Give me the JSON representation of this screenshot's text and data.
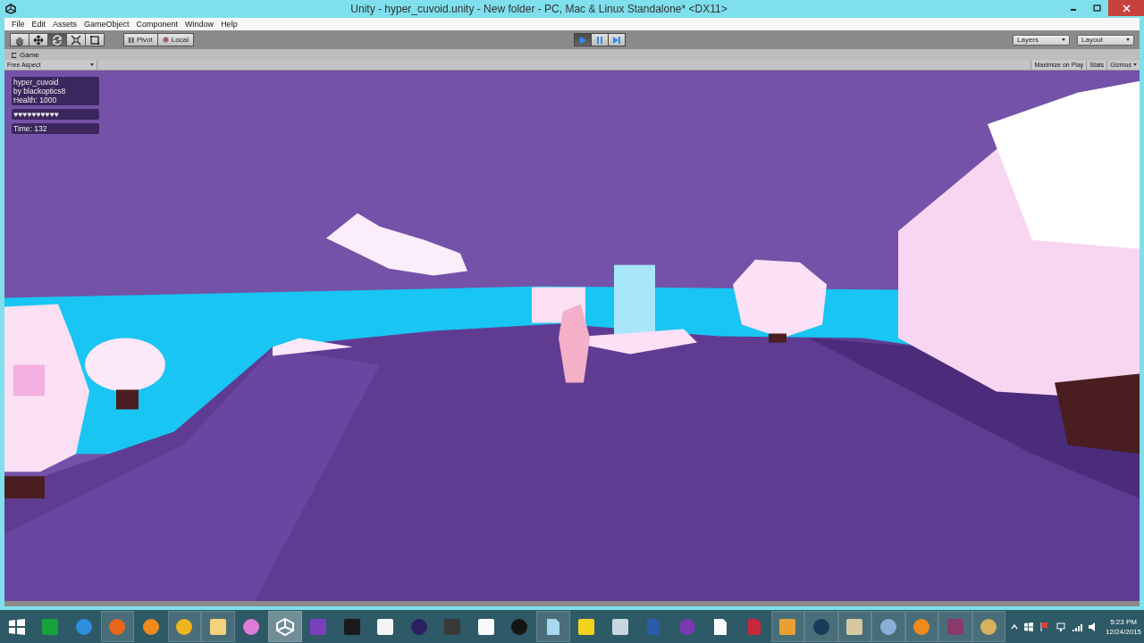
{
  "window": {
    "title": "Unity - hyper_cuvoid.unity - New folder - PC, Mac & Linux Standalone* <DX11>"
  },
  "menu": [
    "File",
    "Edit",
    "Assets",
    "GameObject",
    "Component",
    "Window",
    "Help"
  ],
  "tools": [
    {
      "kind": "hand",
      "selected": false
    },
    {
      "kind": "move",
      "selected": false
    },
    {
      "kind": "rotate",
      "selected": true
    },
    {
      "kind": "scale",
      "selected": false
    },
    {
      "kind": "rect",
      "selected": false
    }
  ],
  "pivot_buttons": [
    {
      "kind": "pivot",
      "label": "Pivot"
    },
    {
      "kind": "local",
      "label": "Local"
    }
  ],
  "playback": [
    {
      "kind": "play",
      "selected": true
    },
    {
      "kind": "pause",
      "selected": false
    },
    {
      "kind": "step",
      "selected": false
    }
  ],
  "dropdowns": [
    "Layers",
    "Layout"
  ],
  "game_panel": {
    "tab": "Game",
    "aspect": "Free Aspect",
    "options": [
      "Maximize on Play",
      "Stats",
      "Gizmos"
    ]
  },
  "hud": {
    "info": [
      "hyper_cuvoid",
      "by blackoptics8",
      "Health: 1000"
    ],
    "hearts": "♥♥♥♥♥♥♥♥♥♥",
    "time": "Time: 132"
  },
  "taskbar": {
    "apps": [
      {
        "kind": "tiles",
        "color": "#ffffff",
        "running": false,
        "selected": false
      },
      {
        "kind": "square",
        "color": "#18a33a",
        "running": false,
        "selected": false
      },
      {
        "kind": "circle",
        "color": "#2f8fdc",
        "running": false,
        "selected": false
      },
      {
        "kind": "circle",
        "color": "#e8661c",
        "running": true,
        "selected": false
      },
      {
        "kind": "circle",
        "color": "#f08a1c",
        "running": false,
        "selected": false
      },
      {
        "kind": "circle",
        "color": "#f0b41c",
        "running": true,
        "selected": false
      },
      {
        "kind": "square",
        "color": "#f2d27a",
        "running": true,
        "selected": false
      },
      {
        "kind": "circle",
        "color": "#e07ad8",
        "running": false,
        "selected": false
      },
      {
        "kind": "triangle",
        "color": "#ffffff",
        "running": true,
        "selected": true
      },
      {
        "kind": "square",
        "color": "#7b3fbf",
        "running": false,
        "selected": false
      },
      {
        "kind": "square",
        "color": "#1a1a1a",
        "running": false,
        "selected": false
      },
      {
        "kind": "square",
        "color": "#f4f4f4",
        "running": false,
        "selected": false
      },
      {
        "kind": "circle",
        "color": "#2c2060",
        "running": false,
        "selected": false
      },
      {
        "kind": "square",
        "color": "#3a3a3a",
        "running": false,
        "selected": false
      },
      {
        "kind": "square",
        "color": "#fafafa",
        "running": false,
        "selected": false
      },
      {
        "kind": "circle",
        "color": "#151515",
        "running": false,
        "selected": false
      },
      {
        "kind": "page",
        "color": "#a8d8f0",
        "running": true,
        "selected": false
      },
      {
        "kind": "square",
        "color": "#f2d21c",
        "running": false,
        "selected": false
      },
      {
        "kind": "square",
        "color": "#c8d8e0",
        "running": false,
        "selected": false
      },
      {
        "kind": "page",
        "color": "#2a5caa",
        "running": false,
        "selected": false
      },
      {
        "kind": "circle",
        "color": "#7a3ab0",
        "running": false,
        "selected": false
      },
      {
        "kind": "page",
        "color": "#fafafa",
        "running": false,
        "selected": false
      },
      {
        "kind": "page",
        "color": "#c8283a",
        "running": false,
        "selected": false
      },
      {
        "kind": "square",
        "color": "#e8a030",
        "running": true,
        "selected": false
      },
      {
        "kind": "circle",
        "color": "#1a3a5a",
        "running": true,
        "selected": false
      },
      {
        "kind": "square",
        "color": "#d8c8a0",
        "running": true,
        "selected": false
      },
      {
        "kind": "circle",
        "color": "#8ab0d8",
        "running": true,
        "selected": false
      },
      {
        "kind": "circle",
        "color": "#f08a1c",
        "running": true,
        "selected": false
      },
      {
        "kind": "square",
        "color": "#8a3a6a",
        "running": true,
        "selected": false
      },
      {
        "kind": "circle",
        "color": "#d8b060",
        "running": true,
        "selected": false
      }
    ],
    "clock": {
      "time": "5:23 PM",
      "date": "12/24/2015"
    }
  }
}
